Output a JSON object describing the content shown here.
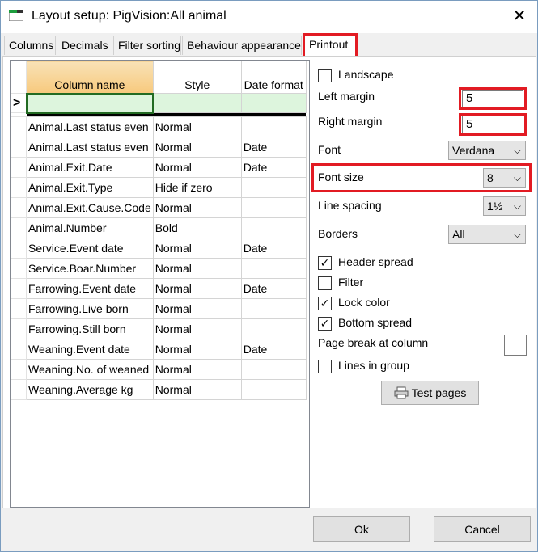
{
  "window": {
    "title": "Layout setup: PigVision:All animal",
    "close_glyph": "✕",
    "icon": "app-icon"
  },
  "tabs": [
    "Columns",
    "Decimals",
    "Filter sorting",
    "Behaviour",
    "appearance",
    "Printout"
  ],
  "active_tab": "Printout",
  "grid": {
    "headers": [
      "Column name",
      "Style",
      "Date format"
    ],
    "current_row_marker": ">",
    "rows": [
      [
        "Animal.Last status even",
        "Normal",
        ""
      ],
      [
        "Animal.Last status even",
        "Normal",
        "Date"
      ],
      [
        "Animal.Exit.Date",
        "Normal",
        "Date"
      ],
      [
        "Animal.Exit.Type",
        "Hide if zero",
        ""
      ],
      [
        "Animal.Exit.Cause.Code",
        "Normal",
        ""
      ],
      [
        "Animal.Number",
        "Bold",
        ""
      ],
      [
        "Service.Event date",
        "Normal",
        "Date"
      ],
      [
        "Service.Boar.Number",
        "Normal",
        ""
      ],
      [
        "Farrowing.Event date",
        "Normal",
        "Date"
      ],
      [
        "Farrowing.Live born",
        "Normal",
        ""
      ],
      [
        "Farrowing.Still born",
        "Normal",
        ""
      ],
      [
        "Weaning.Event date",
        "Normal",
        "Date"
      ],
      [
        "Weaning.No. of weaned",
        "Normal",
        ""
      ],
      [
        "Weaning.Average kg",
        "Normal",
        ""
      ]
    ]
  },
  "printout": {
    "landscape": {
      "label": "Landscape",
      "checked": false
    },
    "left_margin": {
      "label": "Left margin",
      "value": "5"
    },
    "right_margin": {
      "label": "Right margin",
      "value": "5"
    },
    "font": {
      "label": "Font",
      "value": "Verdana"
    },
    "font_size": {
      "label": "Font size",
      "value": "8"
    },
    "line_spacing": {
      "label": "Line spacing",
      "value": "1½"
    },
    "borders": {
      "label": "Borders",
      "value": "All"
    },
    "header_spread": {
      "label": "Header spread",
      "checked": true
    },
    "filter": {
      "label": "Filter",
      "checked": false
    },
    "lock_color": {
      "label": "Lock color",
      "checked": true
    },
    "bottom_spread": {
      "label": "Bottom spread",
      "checked": true
    },
    "page_break": {
      "label": "Page break at column",
      "value": ""
    },
    "lines_in_group": {
      "label": "Lines in group",
      "checked": false
    },
    "test_pages": {
      "label": "Test pages",
      "icon": "printer-icon"
    },
    "check_glyph": "✓",
    "dropdown_glyph": "⌵"
  },
  "footer": {
    "ok": "Ok",
    "cancel": "Cancel"
  },
  "colors": {
    "highlight": "#e21b23",
    "grid_header": "#f7c97d",
    "new_row": "#ddf5dd"
  }
}
